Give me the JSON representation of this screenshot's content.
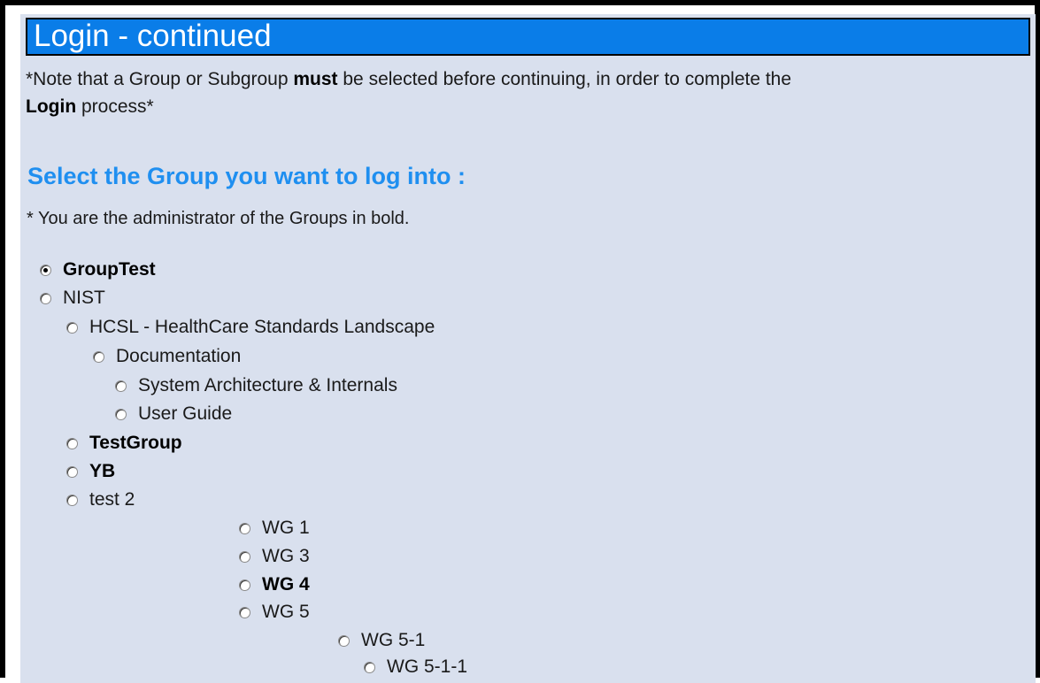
{
  "header": {
    "title": "Login - continued"
  },
  "note": {
    "part1": "*Note that a Group or Subgroup ",
    "must": "must",
    "part2": " be selected before continuing, in order to complete the ",
    "login": "Login",
    "part3": " process*"
  },
  "heading": "Select the Group you want to log into :",
  "admin_note": "* You are the administrator of the Groups in bold.",
  "groups": [
    {
      "label": "GroupTest",
      "bold": true,
      "selected": true
    },
    {
      "label": "NIST",
      "bold": false,
      "selected": false
    },
    {
      "label": "HCSL - HealthCare Standards Landscape",
      "bold": false,
      "selected": false
    },
    {
      "label": "Documentation",
      "bold": false,
      "selected": false
    },
    {
      "label": "System Architecture & Internals",
      "bold": false,
      "selected": false
    },
    {
      "label": "User Guide",
      "bold": false,
      "selected": false
    },
    {
      "label": "TestGroup",
      "bold": true,
      "selected": false
    },
    {
      "label": "YB",
      "bold": true,
      "selected": false
    },
    {
      "label": "test 2",
      "bold": false,
      "selected": false
    },
    {
      "label": "WG 1",
      "bold": false,
      "selected": false
    },
    {
      "label": "WG 3",
      "bold": false,
      "selected": false
    },
    {
      "label": "WG 4",
      "bold": true,
      "selected": false
    },
    {
      "label": "WG 5",
      "bold": false,
      "selected": false
    },
    {
      "label": "WG 5-1",
      "bold": false,
      "selected": false
    },
    {
      "label": "WG 5-1-1",
      "bold": false,
      "selected": false
    }
  ]
}
